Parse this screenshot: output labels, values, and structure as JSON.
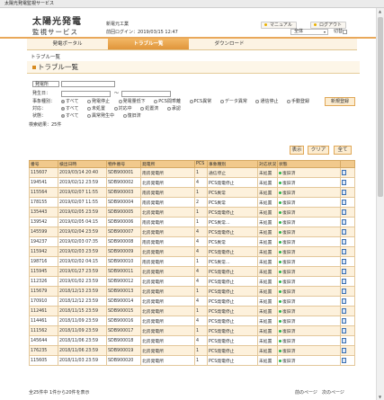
{
  "window_title": "太陽光発電監視サービス",
  "header": {
    "logo_line1": "太陽光発電",
    "logo_line2": "監視サービス",
    "user_name": "新電元工業",
    "last_login": "前回ログイン：2019/03/15 12:47",
    "manual_label": "マニュアル",
    "logout_label": "ログアウト",
    "scope_select": "全体",
    "switch_label": "切替"
  },
  "nav": {
    "tabs": [
      {
        "label": "発電ポータル",
        "active": false
      },
      {
        "label": "トラブル一覧",
        "active": true
      },
      {
        "label": "ダウンロード",
        "active": false
      }
    ]
  },
  "breadcrumb": "トラブル一覧",
  "page_title": "トラブル一覧",
  "filters": {
    "plant_select": "発電所",
    "period_label": "発生日：",
    "period_sep": "～",
    "event_label": "事象種別：",
    "event_options": [
      "すべて",
      "発電停止",
      "発電量低下",
      "PCS間乖離",
      "PCS異常",
      "データ異常",
      "通信停止",
      "手動登録"
    ],
    "status_label": "対応：",
    "status_options": [
      "すべて",
      "未処置",
      "対応中",
      "処置済",
      "承認"
    ],
    "state_label": "状態：",
    "state_options": [
      "すべて",
      "異常発生中",
      "復旧済"
    ],
    "result_count": "検索結果：25件",
    "new_button": "新規登録",
    "show_button": "表示",
    "clear_button": "クリア",
    "all_button": "全て"
  },
  "table": {
    "headers": [
      "番号",
      "検出日時",
      "物件番号",
      "発電所",
      "PCS",
      "事象種別",
      "対応状況",
      "状態",
      ""
    ],
    "rows": [
      [
        "115607",
        "2019/03/14 20:40",
        "SDB900001",
        "南房発電所",
        "1",
        "通信停止",
        "未処置",
        "復旧済"
      ],
      [
        "194541",
        "2019/02/12 23:59",
        "SDB900002",
        "北房発電所",
        "4",
        "PCS発電停止",
        "未処置",
        "復旧済"
      ],
      [
        "115564",
        "2019/02/07 11:55",
        "SDB900003",
        "南房発電所",
        "1",
        "PCS異常",
        "未処置",
        "復旧済"
      ],
      [
        "178155",
        "2019/02/07 11:55",
        "SDB900004",
        "南房発電所",
        "2",
        "PCS異常",
        "未処置",
        "復旧済"
      ],
      [
        "135443",
        "2019/02/05 23:59",
        "SDB900005",
        "北房発電所",
        "1",
        "PCS発電停止",
        "未処置",
        "復旧済"
      ],
      [
        "139542",
        "2019/02/05 04:15",
        "SDB900006",
        "南房発電所",
        "1",
        "PCS異常…",
        "未処置",
        "復旧済"
      ],
      [
        "145599",
        "2019/02/04 23:59",
        "SDB900007",
        "北房発電所",
        "4",
        "PCS発電停止",
        "未処置",
        "復旧済"
      ],
      [
        "194237",
        "2019/02/03 07:35",
        "SDB900008",
        "南房発電所",
        "4",
        "PCS異常",
        "未処置",
        "復旧済"
      ],
      [
        "115942",
        "2019/02/03 23:59",
        "SDB900009",
        "北房発電所",
        "4",
        "PCS発電停止",
        "未処置",
        "復旧済"
      ],
      [
        "198716",
        "2019/02/02 04:15",
        "SDB900010",
        "南房発電所",
        "1",
        "PCS異常…",
        "未処置",
        "復旧済"
      ],
      [
        "115945",
        "2019/01/27 23:59",
        "SDB900011",
        "北房発電所",
        "4",
        "PCS発電停止",
        "未処置",
        "復旧済"
      ],
      [
        "112326",
        "2019/01/02 23:59",
        "SDB900012",
        "北房発電所",
        "4",
        "PCS発電停止",
        "未処置",
        "復旧済"
      ],
      [
        "115679",
        "2018/12/13 23:59",
        "SDB900013",
        "北房発電所",
        "1",
        "PCS発電停止",
        "未処置",
        "復旧済"
      ],
      [
        "170910",
        "2018/12/12 23:59",
        "SDB900014",
        "北房発電所",
        "4",
        "PCS発電停止",
        "未処置",
        "復旧済"
      ],
      [
        "112461",
        "2018/11/15 23:59",
        "SDB900015",
        "北房発電所",
        "1",
        "PCS発電停止",
        "未処置",
        "復旧済"
      ],
      [
        "114461",
        "2018/11/09 23:59",
        "SDB900016",
        "北房発電所",
        "4",
        "PCS発電停止",
        "未処置",
        "復旧済"
      ],
      [
        "111562",
        "2018/11/09 23:59",
        "SDB900017",
        "北房発電所",
        "1",
        "PCS発電停止",
        "未処置",
        "復旧済"
      ],
      [
        "145644",
        "2018/11/06 23:59",
        "SDB900018",
        "北房発電所",
        "4",
        "PCS発電停止",
        "未処置",
        "復旧済"
      ],
      [
        "176235",
        "2018/11/06 23:59",
        "SDB900019",
        "北房発電所",
        "1",
        "PCS発電停止",
        "未処置",
        "復旧済"
      ],
      [
        "115605",
        "2018/11/03 23:59",
        "SDB900020",
        "北房発電所",
        "1",
        "PCS発電停止",
        "未処置",
        "復旧済"
      ]
    ]
  },
  "footer": {
    "summary": "全25件中 1件から20件を表示",
    "prev": "前のページ",
    "next": "次のページ"
  }
}
